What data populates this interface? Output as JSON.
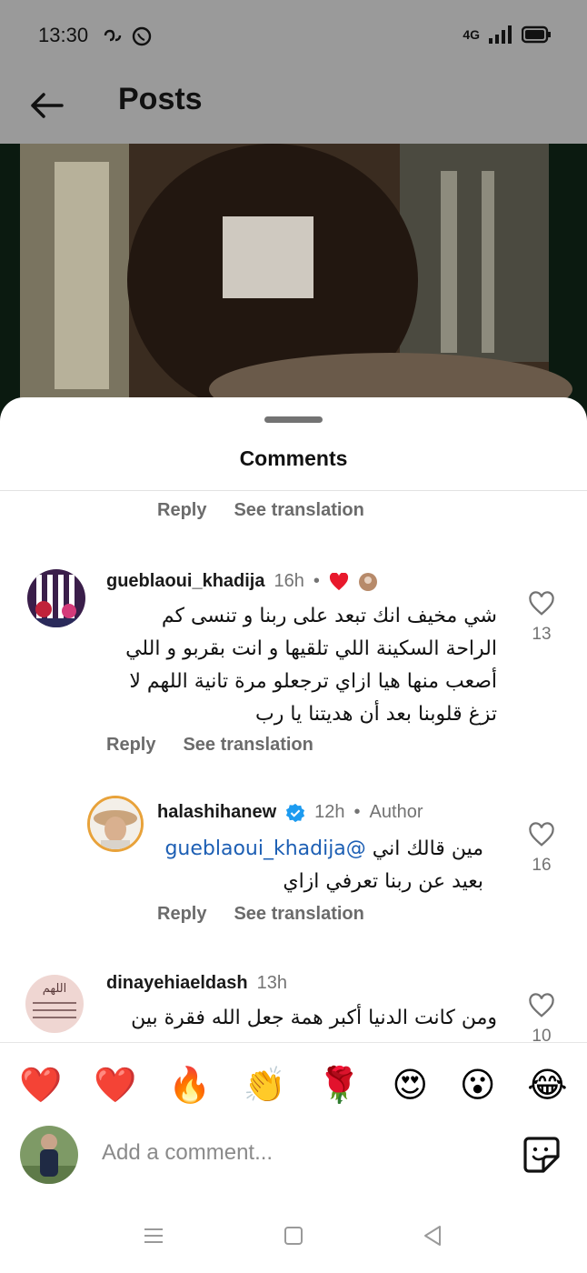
{
  "status_bar": {
    "time": "13:30",
    "network": "4G"
  },
  "app_bar": {
    "title": "Posts",
    "back_icon": "arrow-left-icon"
  },
  "comments_sheet": {
    "title": "Comments",
    "top_actions": {
      "reply": "Reply",
      "see_translation": "See translation"
    },
    "comments": [
      {
        "username": "gueblaoui_khadija",
        "time": "16h",
        "text": "شي مخيف انك تبعد على ربنا و تنسى كم الراحة السكينة اللي تلقيها و انت بقربو و اللي أصعب منها هيا ازاي ترجعلو مرة تانية اللهم لا تزغ قلوبنا بعد أن هديتنا يا رب",
        "likes": "13",
        "reply": "Reply",
        "see_translation": "See translation"
      },
      {
        "username": "halashihanew",
        "time": "12h",
        "author_label": "Author",
        "verified": true,
        "mention": "@gueblaoui_khadija",
        "text_line1": "مين قالك اني",
        "text_line2": "بعيد عن ربنا تعرفي ازاي",
        "likes": "16",
        "reply": "Reply",
        "see_translation": "See translation"
      },
      {
        "username": "dinayehiaeldash",
        "time": "13h",
        "avatar_text": "اللهم",
        "text": "ومن كانت الدنيا أكبر همة جعل الله فقرة بين",
        "likes": "10"
      }
    ],
    "emoji_reactions": [
      "❤️",
      "❤️",
      "🔥",
      "👏",
      "🌹",
      "😍",
      "😮",
      "😂"
    ],
    "compose": {
      "placeholder": "Add a comment...",
      "sticker_icon": "sticker-icon"
    }
  },
  "colors": {
    "mention": "#1d5fb4",
    "verified": "#1d9bf0",
    "heart_red": "#e8192c",
    "muted": "#737373"
  }
}
